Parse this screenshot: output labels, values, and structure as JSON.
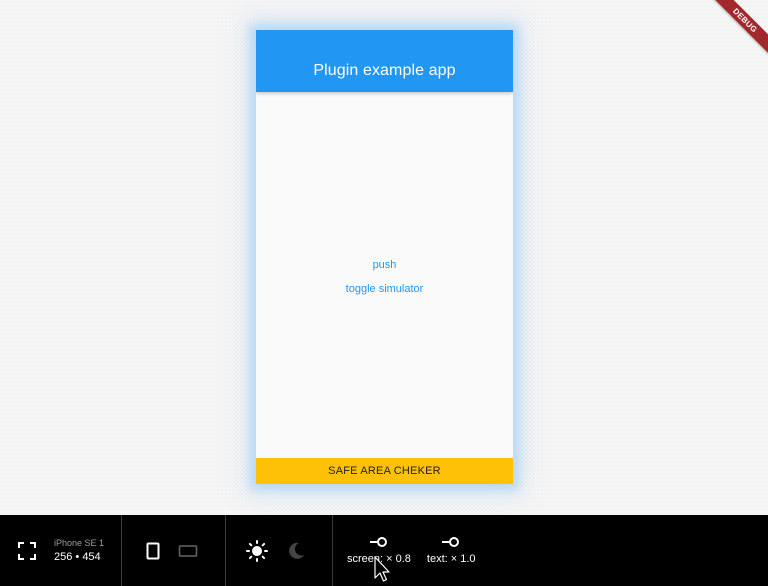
{
  "app": {
    "title": "Plugin example app",
    "buttons": {
      "push": "push",
      "toggle_simulator": "toggle simulator"
    },
    "safe_area_label": "SAFE AREA CHEKER"
  },
  "debug_banner": "DEBUG",
  "toolbar": {
    "device_name": "iPhone SE 1",
    "device_size": "256 • 454",
    "screen_scale": "screen: × 0.8",
    "text_scale": "text: × 1.0",
    "icons": {
      "fullscreen": "fullscreen-icon",
      "portrait": "portrait-phone-icon",
      "landscape": "landscape-phone-icon",
      "light": "sun-icon",
      "dark": "moon-icon",
      "screen_scale": "slider-key-icon",
      "text_scale": "slider-key-icon"
    }
  },
  "colors": {
    "appbar": "#2196f3",
    "link": "#2196f3",
    "safe_area": "#ffc107",
    "debug": "#a3282c",
    "toolbar_bg": "#000000"
  }
}
